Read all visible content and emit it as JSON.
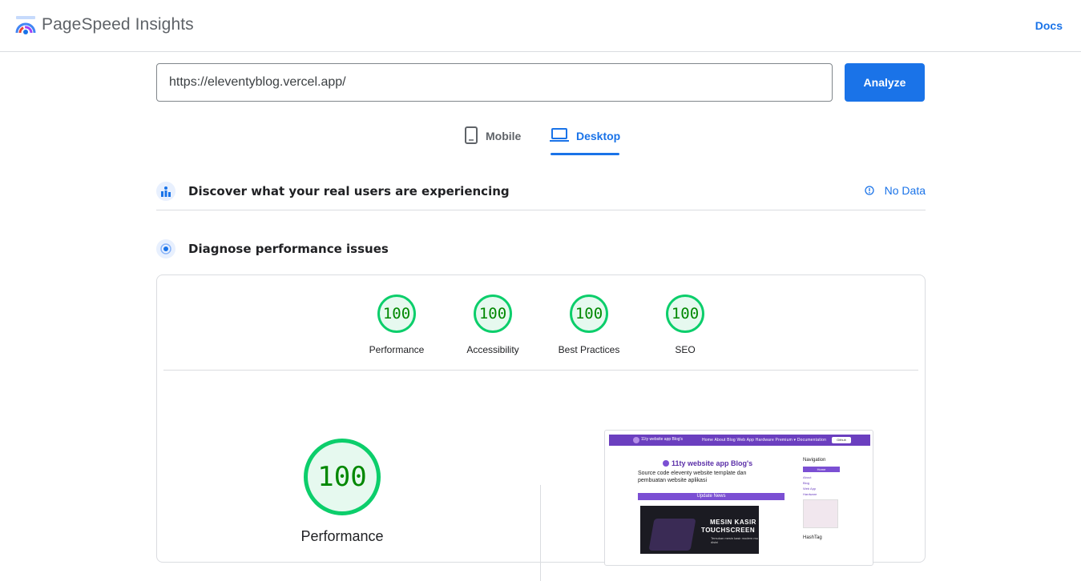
{
  "header": {
    "brand": "PageSpeed Insights",
    "docs_label": "Docs"
  },
  "search": {
    "value": "https://eleventyblog.vercel.app/",
    "analyze_label": "Analyze"
  },
  "tabs": [
    {
      "label": "Mobile",
      "icon": "phone-icon",
      "active": false
    },
    {
      "label": "Desktop",
      "icon": "laptop-icon",
      "active": true
    }
  ],
  "crux": {
    "title": "Discover what your real users are experiencing",
    "status": "No Data"
  },
  "diagnose": {
    "title": "Diagnose performance issues"
  },
  "scores": [
    {
      "value": "100",
      "label": "Performance"
    },
    {
      "value": "100",
      "label": "Accessibility"
    },
    {
      "value": "100",
      "label": "Best Practices"
    },
    {
      "value": "100",
      "label": "SEO"
    }
  ],
  "main_score": {
    "value": "100",
    "label": "Performance"
  },
  "screenshot": {
    "site_name": "11ty website app Blog's",
    "menu": "Home  About  Blog  Web App  Hardware  Premium ▾  Documentation",
    "github": "Github",
    "title": "11ty website app Blog's",
    "desc": "Source code eleventy website template dan pembuatan website aplikasi",
    "bar": "Update News",
    "img_line1": "MESIN KASIR :",
    "img_line2": "TOUCHSCREEN",
    "img_line3": "Temukan mesin kasir modern mu disini",
    "side_title": "Navigation",
    "side_home": "Home",
    "side_links": [
      "About",
      "Blog",
      "Web App",
      "Hardware"
    ],
    "hashtag": "HashTag"
  },
  "colors": {
    "accent": "#1a73e8",
    "pass": "#0cce6b",
    "pass_text": "#008800"
  }
}
